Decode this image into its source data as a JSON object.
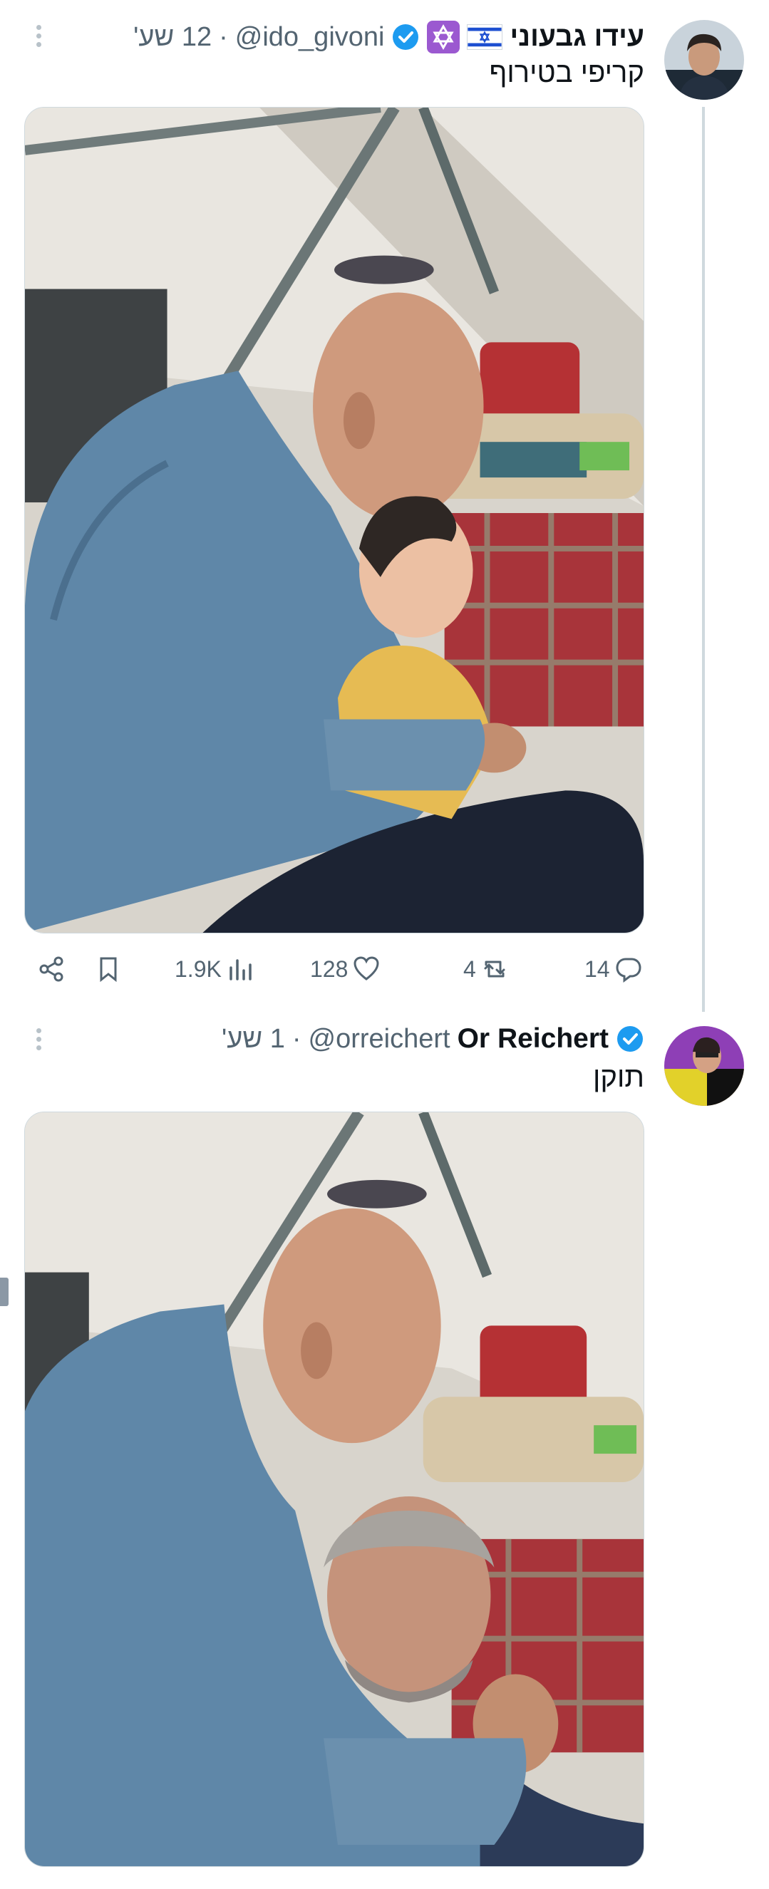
{
  "colors": {
    "verified": "#1d9bf0",
    "secondary_text": "#536471",
    "thread_line": "#cfd9de",
    "background": "#ffffff"
  },
  "tweets": [
    {
      "display_name": "עידו גבעוני",
      "name_badges": [
        "israel-flag-icon",
        "star-of-david-icon"
      ],
      "verified": true,
      "handle": "@ido_givoni",
      "separator": "·",
      "time": "12 שע'",
      "text": "קריפי בטירוף",
      "media_alt_icon": "photo-man-kissing-baby",
      "actions": {
        "replies": "14",
        "reposts": "4",
        "likes": "128",
        "views": "1.9K"
      }
    },
    {
      "display_name": "Or Reichert",
      "verified": true,
      "handle": "@orreichert",
      "separator": "·",
      "time": "1 שע'",
      "text": "תוקן",
      "media_alt_icon": "photo-man-kissing-man"
    }
  ]
}
